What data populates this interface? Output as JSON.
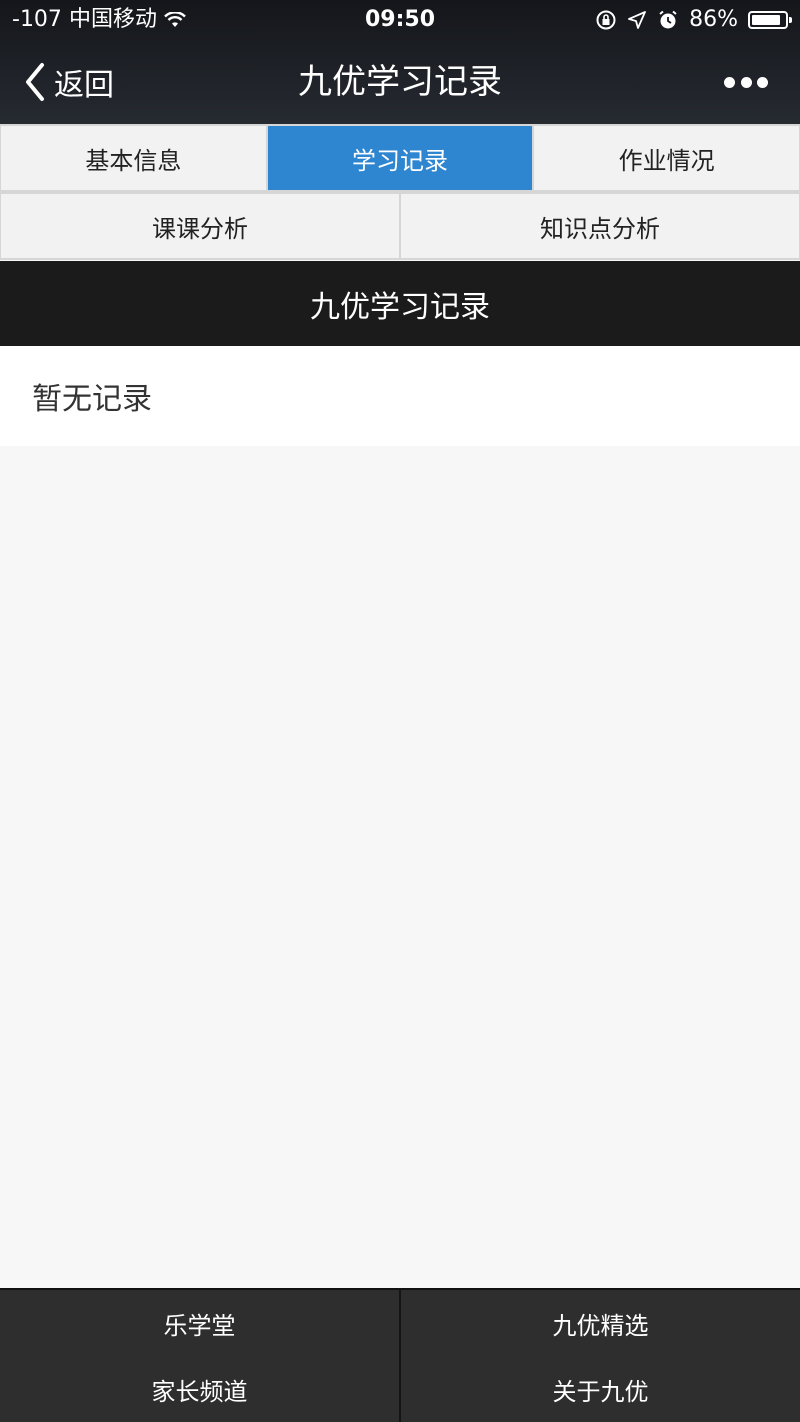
{
  "status_bar": {
    "signal": "-107",
    "carrier": "中国移动",
    "time": "09:50",
    "battery_percent": "86%",
    "battery_level": 0.86
  },
  "nav": {
    "back_label": "返回",
    "title": "九优学习记录"
  },
  "tabs": {
    "row1": [
      "基本信息",
      "学习记录",
      "作业情况"
    ],
    "row2": [
      "课课分析",
      "知识点分析"
    ],
    "active": "学习记录",
    "active_color": "#2f86d0"
  },
  "section": {
    "title": "九优学习记录",
    "empty_text": "暂无记录"
  },
  "bottom_menu": {
    "left": [
      "乐学堂",
      "家长频道"
    ],
    "right": [
      "九优精选",
      "关于九优"
    ]
  }
}
